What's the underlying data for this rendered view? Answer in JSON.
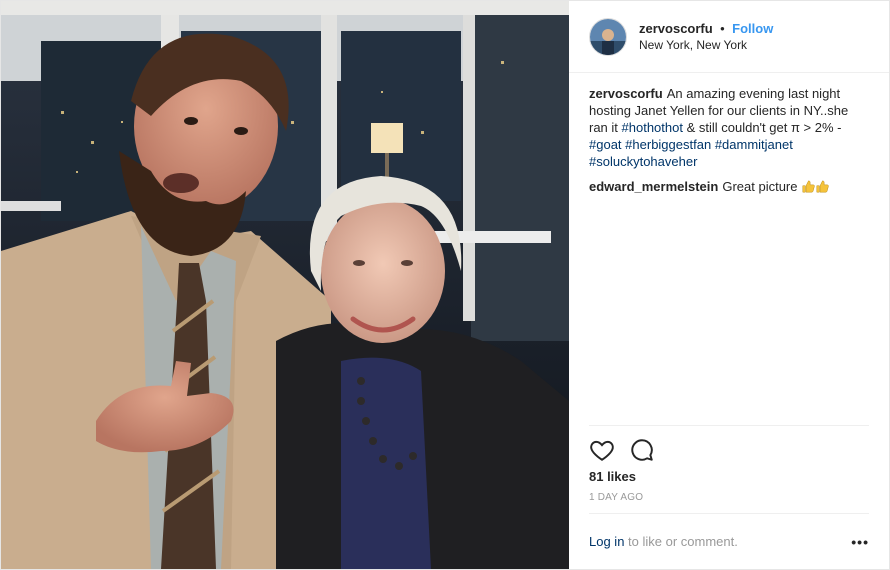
{
  "post": {
    "username": "zervoscorfu",
    "separator": "•",
    "follow_label": "Follow",
    "location": "New York, New York",
    "photo_alt": "zervoscorfu and Janet Yellen at an evening event"
  },
  "caption": {
    "user": "zervoscorfu",
    "text": "An amazing evening last night hosting Janet Yellen for our clients in NY..she ran it ",
    "tag1": "#hothothot",
    "text2": " & still couldn't get π > 2% - ",
    "tag2": "#goat",
    "tag3": "#herbiggestfan",
    "tag4": "#dammitjanet",
    "tag5": "#soluckytohaveher"
  },
  "comment": {
    "user": "edward_mermelstein",
    "text": "Great picture"
  },
  "likes": "81 likes",
  "timestamp": "1 DAY AGO",
  "footer": {
    "login_label": "Log in",
    "rest": " to like or comment.",
    "more": "•••"
  },
  "icons": {
    "like": "heart-icon",
    "comment": "comment-bubble-icon",
    "emoji": "thumbs-up-emoji"
  },
  "colors": {
    "link_blue": "#3897f0",
    "tag_blue": "#003569",
    "thumb_yellow": "#f5c33b"
  }
}
